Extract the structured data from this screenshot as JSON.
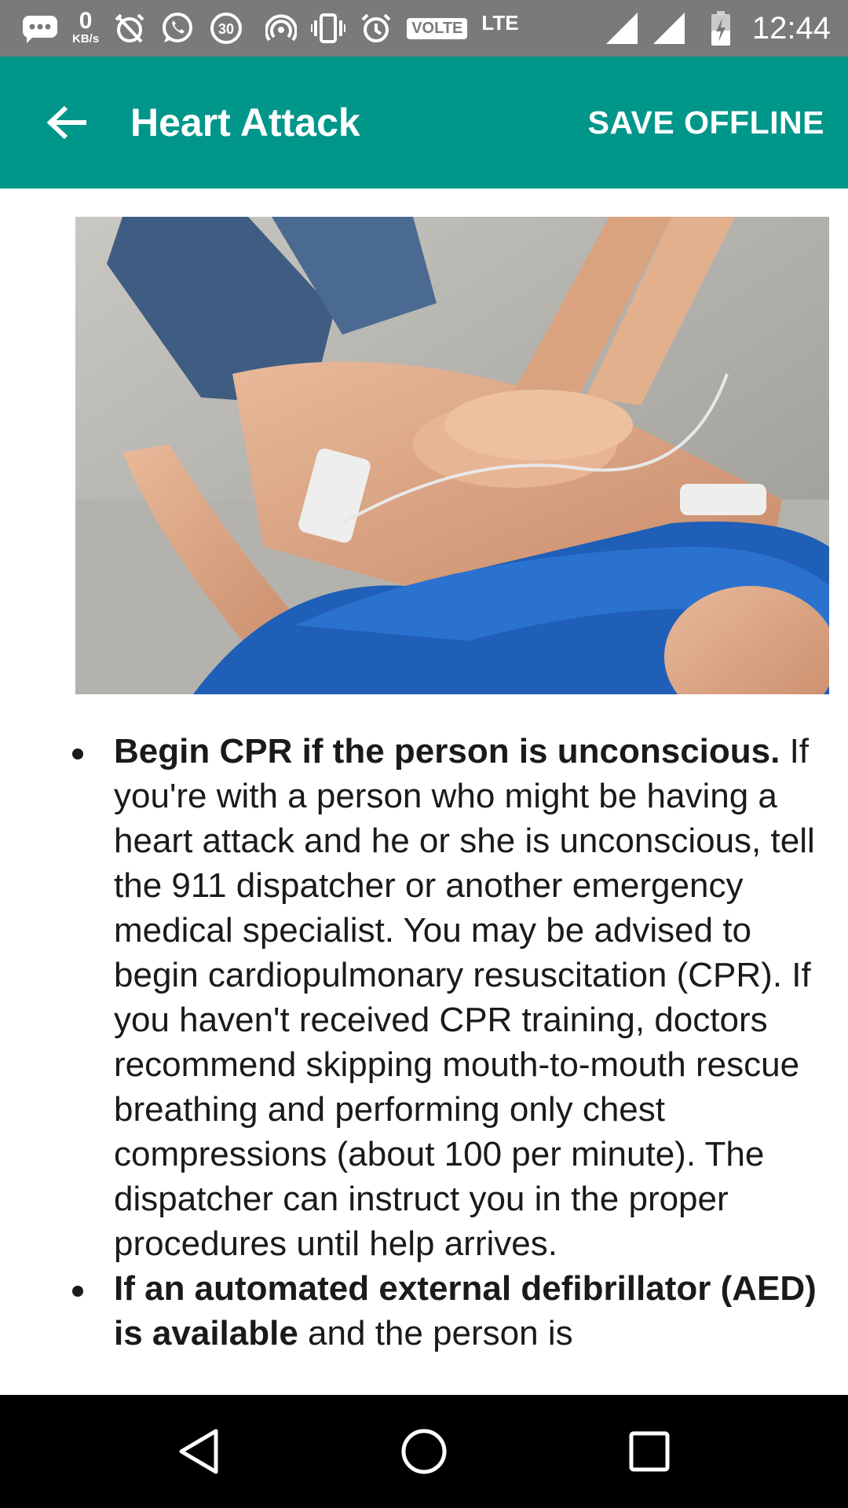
{
  "status_bar": {
    "kb_speed": "0",
    "kb_unit": "KB/s",
    "data_saver_badge": "30",
    "volte_label": "VOLTE",
    "network_label": "LTE",
    "time": "12:44",
    "icons": [
      "chat-bubble-icon",
      "no-alarm-icon",
      "whatsapp-icon",
      "data-saver-icon",
      "hotspot-icon",
      "vibrate-icon",
      "alarm-icon",
      "signal-icon",
      "signal-icon",
      "battery-charging-icon"
    ]
  },
  "app_bar": {
    "title": "Heart Attack",
    "action_label": "SAVE OFFLINE",
    "color": "#00968a"
  },
  "hero": {
    "icon": "cpr-photo"
  },
  "content": {
    "items": [
      {
        "bold": "Begin CPR if the person is unconscious.",
        "text": " If you're with a person who might be having a heart attack and he or she is unconscious, tell the 911 dispatcher or another emergency medical specialist. You may be advised to begin cardiopulmonary resuscitation (CPR). If you haven't received CPR training, doctors recommend skipping mouth-to-mouth rescue breathing and performing only chest compressions (about 100 per minute). The dispatcher can instruct you in the proper procedures until help arrives."
      },
      {
        "bold": "If an automated external defibrillator (AED) is available",
        "text": " and the person is"
      }
    ]
  },
  "nav_bar": {
    "icons": [
      "back-triangle-icon",
      "home-circle-icon",
      "recents-square-icon"
    ]
  }
}
